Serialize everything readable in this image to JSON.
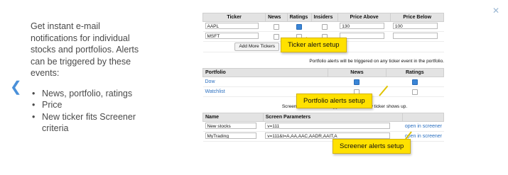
{
  "nav": {
    "prev_icon": "chevron-left-icon",
    "close_icon": "close-icon"
  },
  "description": {
    "intro": "Get instant e-mail notifications for individual stocks and portfolios. Alerts can be triggered by these events:",
    "bullets": [
      "News, portfolio, ratings",
      "Price",
      "New ticker fits Screener criteria"
    ]
  },
  "ticker_table": {
    "headers": [
      "Ticker",
      "News",
      "Ratings",
      "Insiders",
      "Price Above",
      "Price Below"
    ],
    "rows": [
      {
        "ticker": "AAPL",
        "news": false,
        "ratings": true,
        "insiders": false,
        "price_above": "130",
        "price_below": "100"
      },
      {
        "ticker": "MSFT",
        "news": false,
        "ratings": false,
        "insiders": false,
        "price_above": "",
        "price_below": ""
      }
    ],
    "add_button": "Add More Tickers"
  },
  "portfolio_note": "Portfolio alerts will be triggered on any ticker event in the portfolio.",
  "portfolio_table": {
    "headers": [
      "Portfolio",
      "News",
      "Ratings"
    ],
    "rows": [
      {
        "name": "Dow",
        "news": true,
        "ratings": true
      },
      {
        "name": "Watchlist",
        "news": false,
        "ratings": false
      }
    ]
  },
  "screener_note": "Screener alerts will be triggered when a new ticker shows up.",
  "screener_table": {
    "headers": [
      "Name",
      "Screen Parameters"
    ],
    "rows": [
      {
        "name": "New stocks",
        "params": "v=111",
        "link": "open in screener"
      },
      {
        "name": "MyTrading",
        "params": "v=111&t=A,AA,AAC,AADR,AAIT,A",
        "link": "open in screener"
      }
    ]
  },
  "callouts": {
    "ticker": "Ticker alert setup",
    "portfolio": "Portfolio alerts setup",
    "screener": "Screener alerts setup"
  },
  "colors": {
    "callout": "#ffe100",
    "link": "#2a6fc0",
    "checkbox_on": "#3a85d6",
    "nav_arrow": "#4a90d9"
  }
}
